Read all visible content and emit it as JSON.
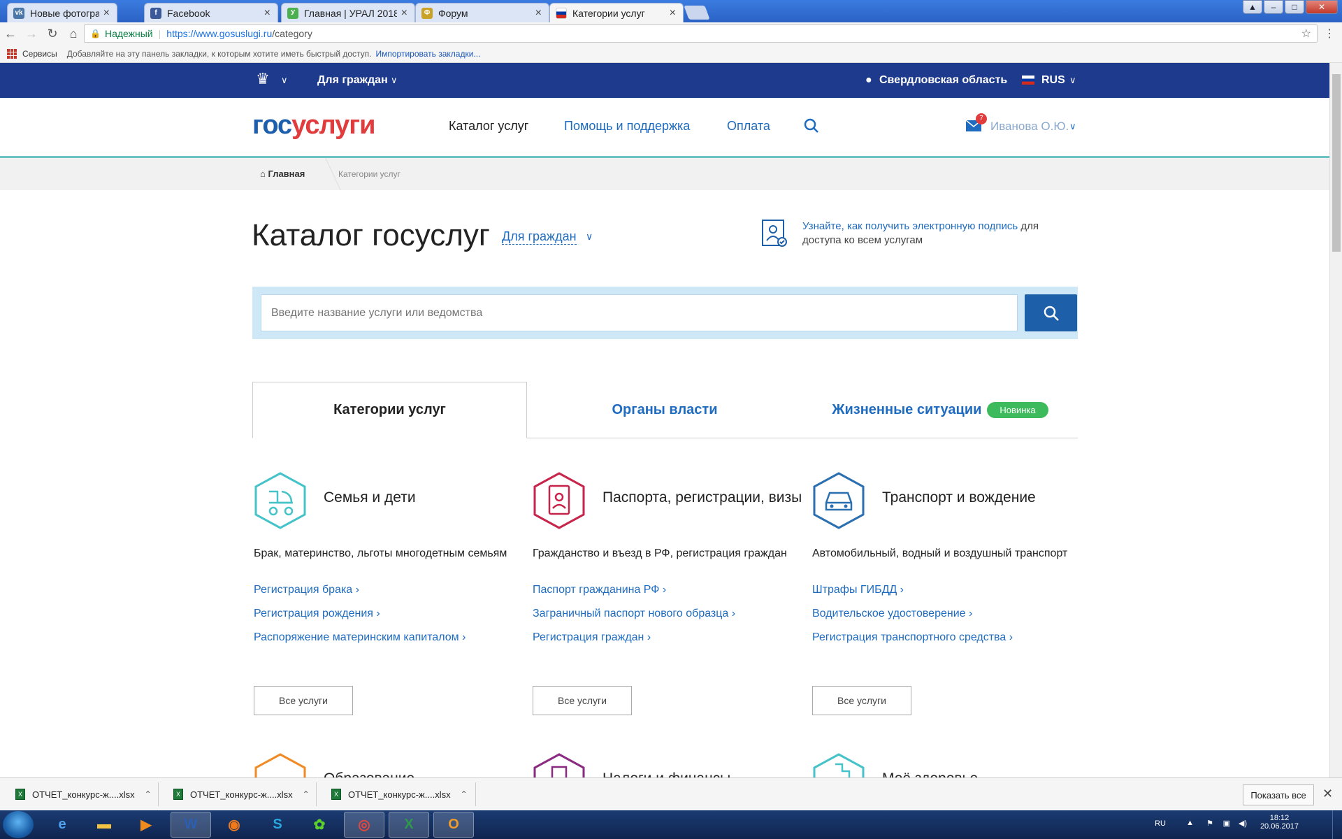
{
  "browser": {
    "tabs": [
      {
        "title": "Новые фотографии",
        "favicon": "vk-icon",
        "color": "#4a76a8"
      },
      {
        "title": "Facebook",
        "favicon": "facebook-icon",
        "color": "#3b5998"
      },
      {
        "title": "Главная | УРАЛ 2018",
        "favicon": "ural-icon",
        "color": "#4caf50"
      },
      {
        "title": "Форум",
        "favicon": "forum-icon",
        "color": "#c9a227"
      },
      {
        "title": "Категории услуг",
        "favicon": "russia-flag-icon",
        "color": "#d52b1e"
      }
    ],
    "secure_label": "Надежный",
    "url_host": "https://www.gosuslugi.ru",
    "url_path": "/category",
    "bookmarks": {
      "services_label": "Сервисы",
      "hint": "Добавляйте на эту панель закладки, к которым хотите иметь быстрый доступ.",
      "import_link": "Импортировать закладки..."
    }
  },
  "site": {
    "topnav": {
      "audience": "Для граждан",
      "region": "Свердловская область",
      "language": "RUS"
    },
    "logo": {
      "part1": "гос",
      "part2": "услуги"
    },
    "nav": {
      "catalog": "Каталог услуг",
      "help": "Помощь и поддержка",
      "payment": "Оплата"
    },
    "user": {
      "name": "Иванова О.Ю.",
      "mail_count": "7"
    },
    "breadcrumb": {
      "home": "Главная",
      "current": "Категории услуг"
    },
    "page_title": "Каталог госуслуг",
    "audience_filter": "Для граждан",
    "signature": {
      "link": "Узнайте, как получить электронную подпись",
      "rest": " для доступа ко всем услугам"
    },
    "search": {
      "placeholder": "Введите название услуги или ведомства"
    },
    "tabs": {
      "categories": "Категории услуг",
      "authorities": "Органы власти",
      "life": "Жизненные ситуации",
      "new_badge": "Новинка"
    },
    "all_services_label": "Все услуги",
    "categories": [
      {
        "title": "Семья и дети",
        "description": "Брак, материнство, льготы многодетным семьям",
        "links": [
          "Регистрация брака",
          "Регистрация рождения",
          "Распоряжение материнским капиталом"
        ],
        "color": "#45c3c8",
        "icon": "baby-stroller-icon"
      },
      {
        "title": "Паспорта, регистрации, визы",
        "description": "Гражданство и въезд в РФ, регистрация граждан",
        "links": [
          "Паспорт гражданина РФ",
          "Заграничный паспорт нового образца",
          "Регистрация граждан"
        ],
        "color": "#c8234b",
        "icon": "passport-icon"
      },
      {
        "title": "Транспорт и вождение",
        "description": "Автомобильный, водный и воздушный транспорт",
        "links": [
          "Штрафы ГИБДД",
          "Водительское удостоверение",
          "Регистрация транспортного средства"
        ],
        "color": "#2a6fb0",
        "icon": "car-icon"
      }
    ],
    "categories_row2": [
      {
        "title": "Образование",
        "color": "#f08a24",
        "icon": "education-icon"
      },
      {
        "title": "Налоги и финансы",
        "color": "#8a2a80",
        "icon": "tax-document-icon"
      },
      {
        "title": "Моё здоровье",
        "color": "#45c3c8",
        "icon": "health-cross-icon"
      }
    ]
  },
  "downloads": {
    "items": [
      "ОТЧЕТ_конкурс-ж....xlsx",
      "ОТЧЕТ_конкурс-ж....xlsx",
      "ОТЧЕТ_конкурс-ж....xlsx"
    ],
    "show_all": "Показать все"
  },
  "taskbar": {
    "lang": "RU",
    "time": "18:12",
    "date": "20.06.2017",
    "apps": [
      "ie-icon",
      "explorer-folder-icon",
      "media-player-icon",
      "word-icon",
      "firefox-icon",
      "skype-icon",
      "icq-icon",
      "chrome-icon",
      "excel-icon",
      "outlook-icon"
    ]
  },
  "colors": {
    "brand_blue": "#1e5fad",
    "brand_red": "#e03b3d",
    "topnav_bg": "#1d3a8c",
    "link": "#1e6bbf",
    "accent_teal": "#6cc4c6",
    "badge_green": "#3dbb5c"
  }
}
